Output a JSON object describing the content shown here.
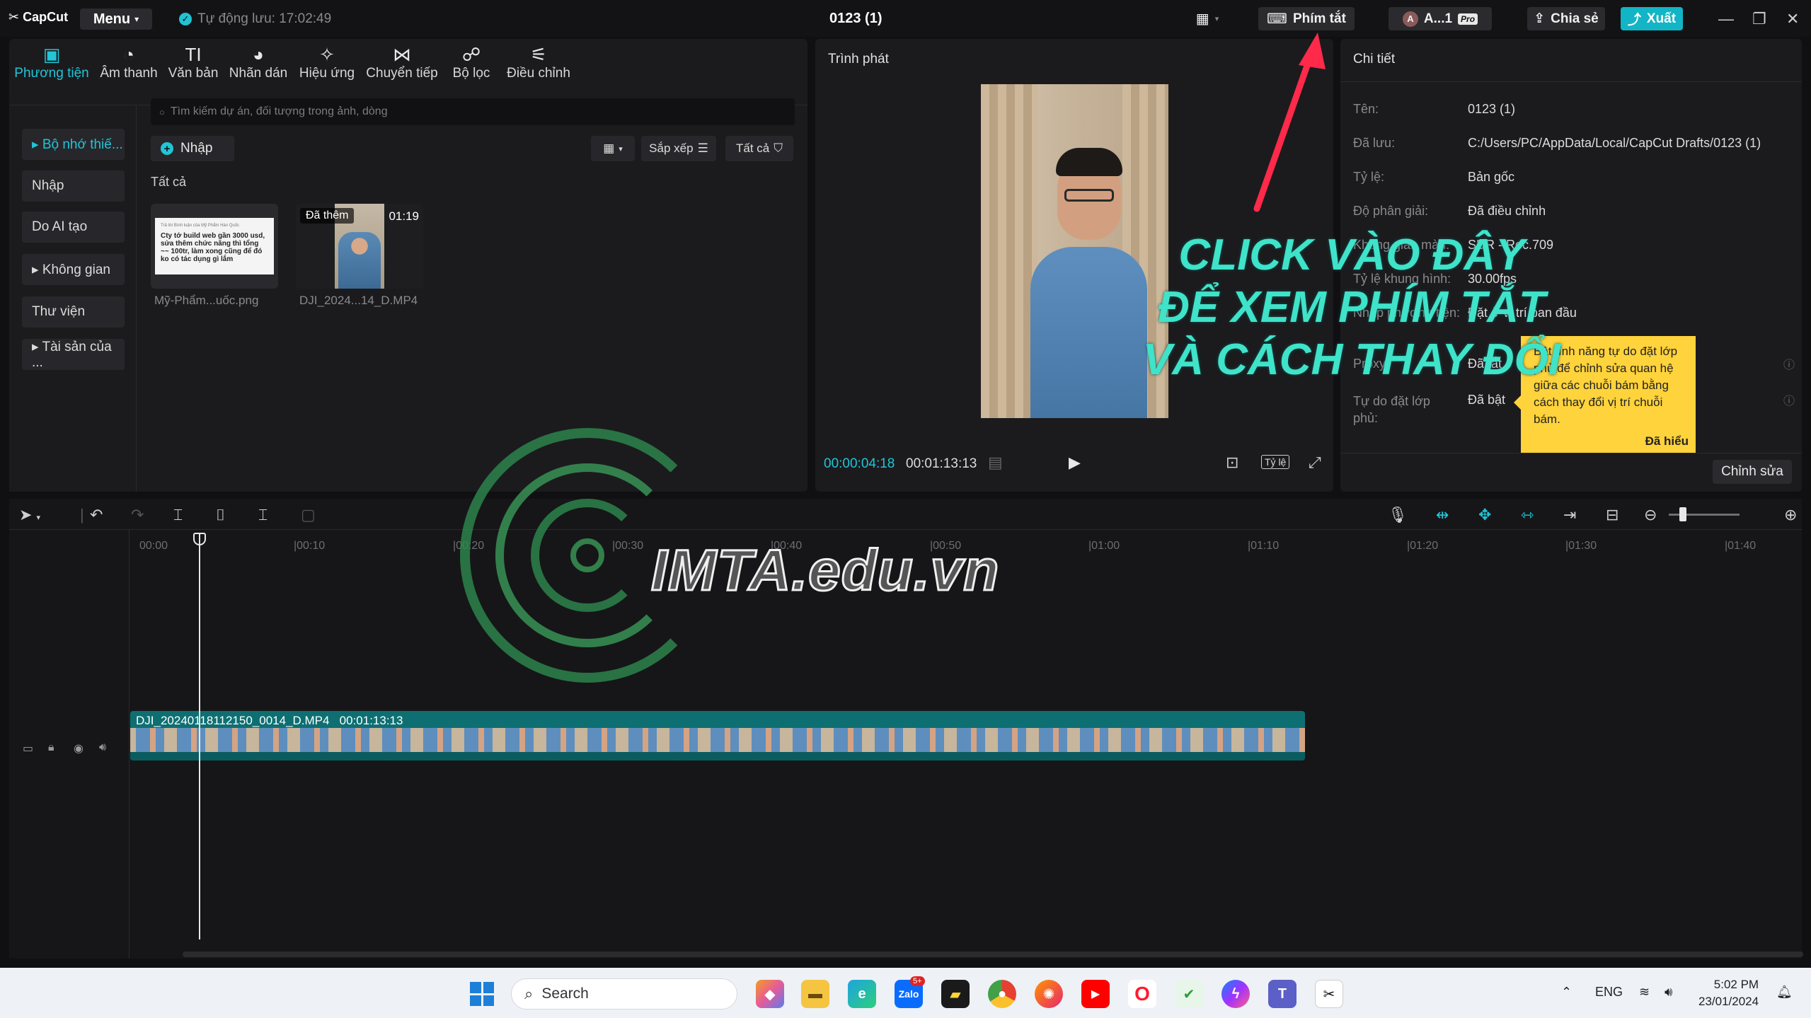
{
  "titlebar": {
    "logo": "CapCut",
    "menu": "Menu",
    "autosave": "Tự động lưu: 17:02:49",
    "project_title": "0123 (1)",
    "shortcuts": "Phím tắt",
    "account": "A...1",
    "pro": "Pro",
    "share": "Chia sẻ",
    "export": "Xuất"
  },
  "media": {
    "tabs": [
      {
        "label": "Phương tiện",
        "icon": "media-icon"
      },
      {
        "label": "Âm thanh",
        "icon": "audio-icon"
      },
      {
        "label": "Văn bản",
        "icon": "text-icon"
      },
      {
        "label": "Nhãn dán",
        "icon": "sticker-icon"
      },
      {
        "label": "Hiệu ứng",
        "icon": "effects-icon"
      },
      {
        "label": "Chuyển tiếp",
        "icon": "transition-icon"
      },
      {
        "label": "Bộ lọc",
        "icon": "filter-icon"
      },
      {
        "label": "Điều chỉnh",
        "icon": "adjust-icon"
      }
    ],
    "side": [
      "▸ Bộ nhớ thiế...",
      "Nhập",
      "Do AI tạo",
      "▸ Không gian",
      "Thư viện",
      "▸ Tài sản của ..."
    ],
    "search_placeholder": "Tìm kiếm dự án, đối tượng trong ảnh, dòng",
    "import": "Nhập",
    "sort": "Sắp xếp",
    "all_filter": "Tất cả",
    "all_label": "Tất cả",
    "thumb1_doc": "Cty tớ build web gần 3000 usd, sửa thêm chức năng thì tổng ~~ 100tr, làm xong cũng để đó ko có tác dụng gì lắm",
    "thumb1_header": "Trả lời Bình luận của Mỹ Phẩm Hàn Quốc",
    "thumb1_name": "Mỹ-Phẩm...uốc.png",
    "thumb2_badge": "Đã thêm",
    "thumb2_duration": "01:19",
    "thumb2_name": "DJI_2024...14_D.MP4"
  },
  "player": {
    "title": "Trình phát",
    "current_time": "00:00:04:18",
    "total_time": "00:01:13:13",
    "ratio": "Tỷ lệ"
  },
  "details": {
    "title": "Chi tiết",
    "rows": [
      {
        "label": "Tên:",
        "value": "0123 (1)"
      },
      {
        "label": "Đã lưu:",
        "value": "C:/Users/PC/AppData/Local/CapCut Drafts/0123 (1)"
      },
      {
        "label": "Tỷ lệ:",
        "value": "Bản gốc"
      },
      {
        "label": "Độ phân giải:",
        "value": "Đã điều chỉnh"
      },
      {
        "label": "Không gian màu:",
        "value": "SDR - Rec.709"
      },
      {
        "label": "Tỷ lệ khung hình:",
        "value": "30.00fps"
      },
      {
        "label": "Nhập phương tiện:",
        "value": "Đặt ở vị trí ban đầu"
      },
      {
        "label": "Proxy:",
        "value": "Đã tắt"
      }
    ],
    "free_layer_label": "Tự do đặt lớp phủ:",
    "free_layer_value": "Đã bật",
    "tooltip": "Bật tính năng tự do đặt lớp phủ để chỉnh sửa quan hệ giữa các chuỗi bám bằng cách thay đổi vị trí chuỗi bám.",
    "tooltip_ok": "Đã hiểu",
    "edit": "Chỉnh sửa"
  },
  "timeline": {
    "ticks": [
      "00:00",
      "|00:10",
      "|00:20",
      "|00:30",
      "|00:40",
      "|00:50",
      "|01:00",
      "|01:10",
      "|01:20",
      "|01:30",
      "|01:40"
    ],
    "clip_name": "DJI_20240118112150_0014_D.MP4",
    "clip_duration": "00:01:13:13"
  },
  "annotation": [
    "CLICK VÀO ĐÂY",
    "ĐỂ XEM PHÍM TẮT",
    "VÀ CÁCH THAY ĐỔI"
  ],
  "watermark": "IMTA.edu.vn",
  "taskbar": {
    "search": "Search",
    "lang": "ENG",
    "time": "5:02 PM",
    "date": "23/01/2024",
    "zalo_badge": "5+"
  },
  "colors": {
    "accent": "#21c5d6",
    "annotation": "#3fe3c9",
    "tooltip": "#ffd33b",
    "arrow": "#ff2a4a"
  }
}
